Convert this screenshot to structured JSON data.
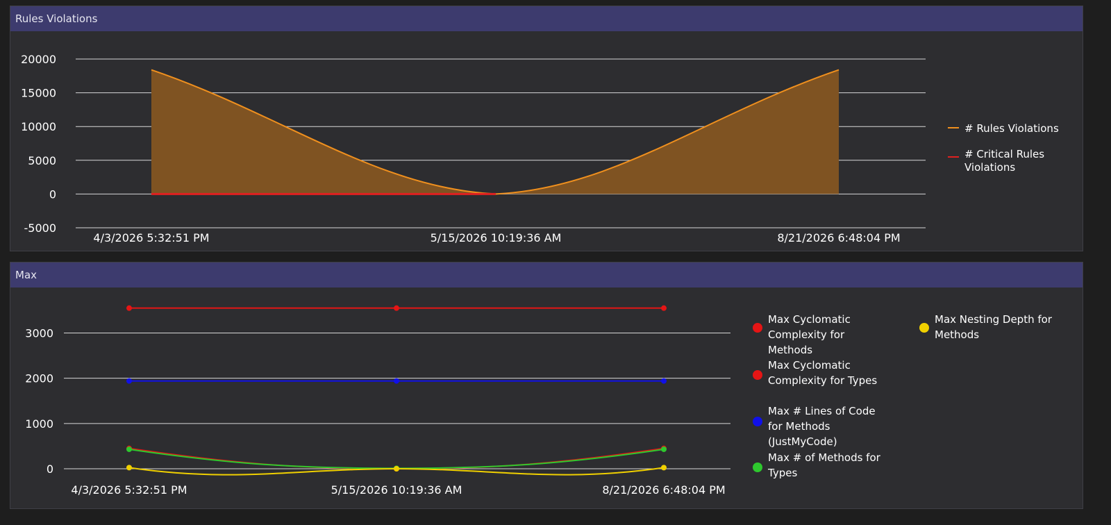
{
  "panels": {
    "rules": {
      "title": "Rules Violations"
    },
    "max": {
      "title": "Max"
    }
  },
  "chart_data": [
    {
      "type": "area",
      "title": "Rules Violations",
      "x": [
        "4/3/2026 5:32:51 PM",
        "5/15/2026 10:19:36 AM",
        "8/21/2026 6:48:04 PM"
      ],
      "ylim": [
        -5000,
        20000
      ],
      "yticks": [
        20000,
        15000,
        10000,
        5000,
        0,
        -5000
      ],
      "grid": true,
      "legend_position": "right",
      "series": [
        {
          "name": "# Rules Violations",
          "color": "#f0901e",
          "fill": "#7f5322",
          "values": [
            18400,
            0,
            18400
          ]
        },
        {
          "name": "# Critical Rules Violations",
          "color": "#e02020",
          "values": [
            0,
            0,
            0
          ]
        }
      ]
    },
    {
      "type": "line",
      "title": "Max",
      "x": [
        "4/3/2026 5:32:51 PM",
        "5/15/2026 10:19:36 AM",
        "8/21/2026 6:48:04 PM"
      ],
      "ylim": [
        -50,
        3800
      ],
      "yticks": [
        3000,
        2000,
        1000,
        0
      ],
      "grid": true,
      "legend_position": "right",
      "series": [
        {
          "name": "Max Cyclomatic Complexity for Methods",
          "color": "#e51515",
          "values": [
            3550,
            3550,
            3550
          ]
        },
        {
          "name": "Max Cyclomatic Complexity for Types",
          "color": "#e51515",
          "values": [
            450,
            0,
            450
          ]
        },
        {
          "name": "Max # Lines of Code for Methods (JustMyCode)",
          "color": "#1010e8",
          "values": [
            1940,
            1940,
            1940
          ]
        },
        {
          "name": "Max # of Methods for Types",
          "color": "#2ec82e",
          "values": [
            430,
            10,
            430
          ]
        },
        {
          "name": "Max Nesting Depth for Methods",
          "color": "#f0d000",
          "values": [
            25,
            0,
            25
          ]
        }
      ]
    }
  ]
}
